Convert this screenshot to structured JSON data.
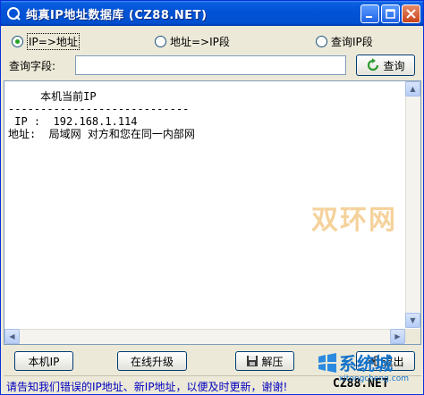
{
  "window": {
    "title": "纯真IP地址数据库  (CZ88.NET)"
  },
  "radios": [
    {
      "label": "IP=>地址",
      "checked": true
    },
    {
      "label": "地址=>IP段",
      "checked": false
    },
    {
      "label": "查询IP段",
      "checked": false
    }
  ],
  "query": {
    "label": "查询字段:",
    "value": "",
    "button_label": "查询"
  },
  "result": {
    "lines": "     本机当前IP\n----------------------------\n IP :  192.168.1.114\n地址:  局域网 对方和您在同一内部网"
  },
  "watermark": "双环网",
  "buttons": {
    "local_ip": "本机IP",
    "online_update": "在线升级",
    "unzip": "解压",
    "exit": "退出"
  },
  "status": {
    "message": "请告知我们错误的IP地址、新IP地址，以便及时更新，谢谢!",
    "brand": "CZ88.NET"
  },
  "logo": {
    "name": "系统城",
    "url": "xitongcheng.com"
  },
  "colors": {
    "titlebar": "#0353d6",
    "status_text": "#0000c0",
    "watermark": "#f2c37c",
    "logo": "#1473c9"
  }
}
